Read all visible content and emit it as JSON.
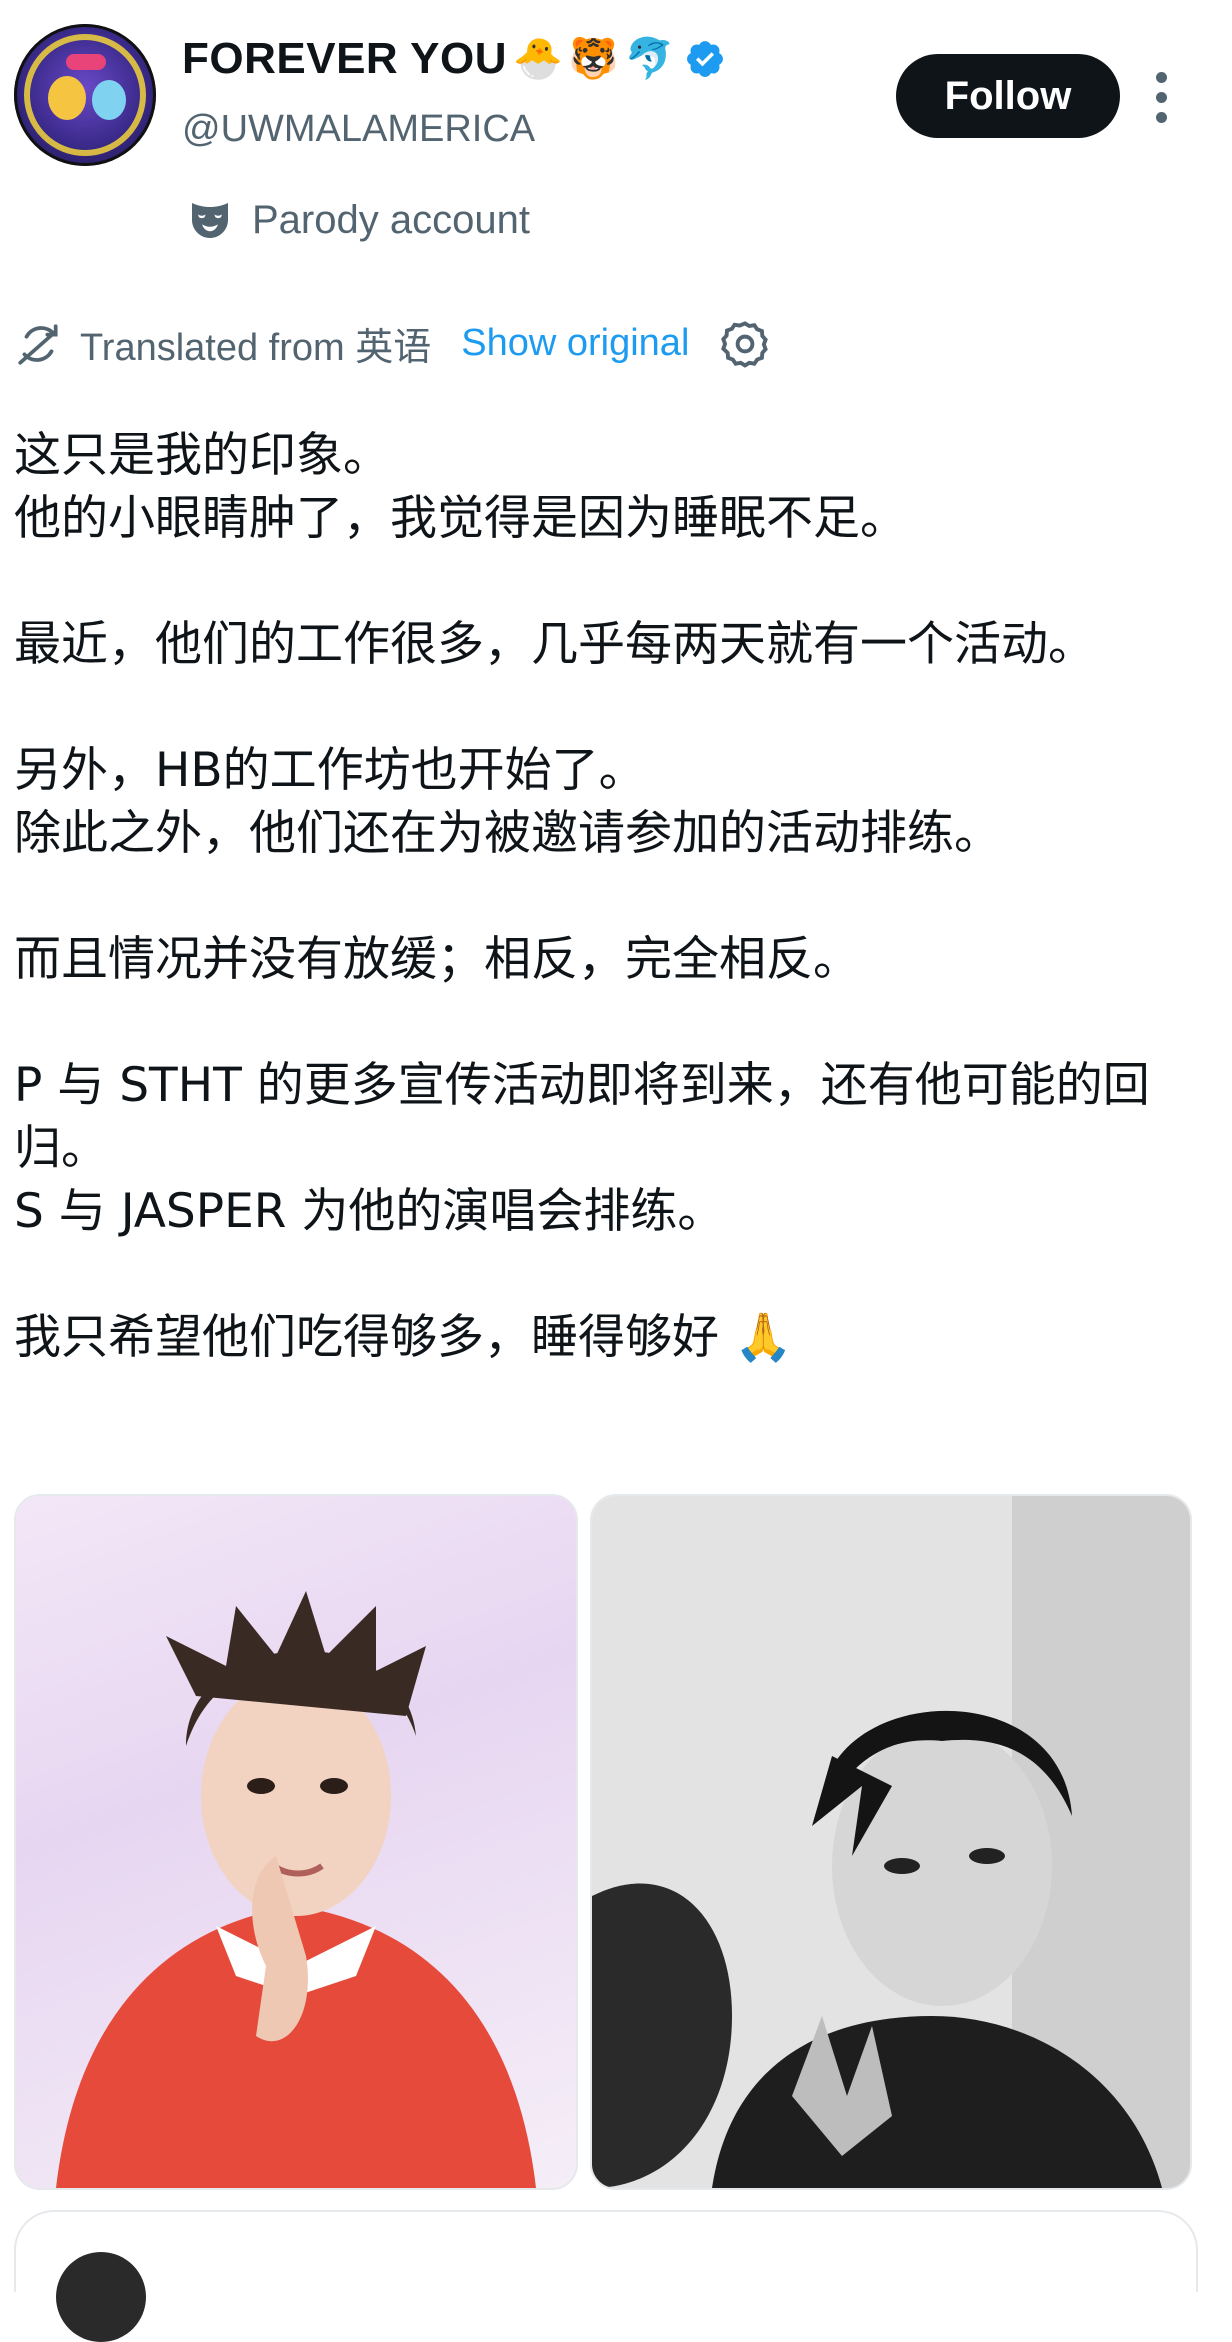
{
  "header": {
    "display_name": "FOREVER YOU",
    "emojis": [
      "🐣",
      "🐯",
      "🐬"
    ],
    "handle": "@UWMALAMERICA",
    "follow_label": "Follow",
    "parody_label": "Parody account"
  },
  "translation": {
    "translated_label": "Translated from 英语",
    "show_original_label": "Show original"
  },
  "tweet": {
    "text": "这只是我的印象。\n他的小眼睛肿了，我觉得是因为睡眠不足。\n\n最近，他们的工作很多，几乎每两天就有一个活动。\n\n另外，HB的工作坊也开始了。\n除此之外，他们还在为被邀请参加的活动排练。\n\n而且情况并没有放缓；相反，完全相反。\n\nP 与 STHT 的更多宣传活动即将到来，还有他可能的回归。\nS 与 JASPER 为他的演唱会排练。\n\n我只希望他们吃得够多，睡得够好 🙏"
  },
  "colors": {
    "accent": "#1d9bf0",
    "text_primary": "#0f1419",
    "text_secondary": "#536471",
    "button_bg": "#0f1419"
  },
  "icons": {
    "verified": "verified-badge-icon",
    "more": "more-vertical-icon",
    "parody": "mask-icon",
    "translate": "translate-icon",
    "settings": "gear-icon"
  }
}
